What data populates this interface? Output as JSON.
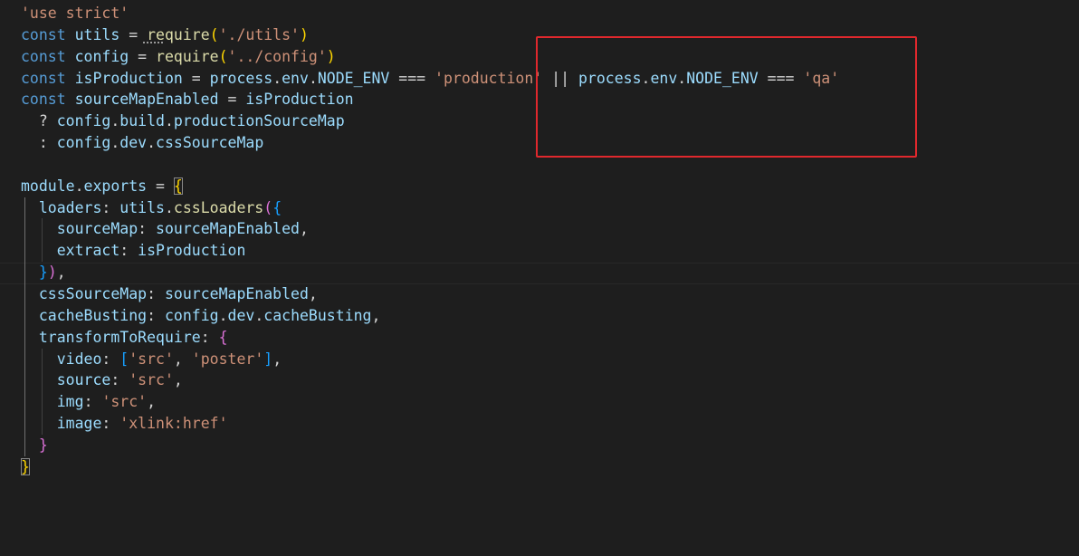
{
  "colors": {
    "background": "#1e1e1e",
    "keyword": "#569cd6",
    "variable": "#9cdcfe",
    "function": "#dcdcaa",
    "string": "#ce9178",
    "text": "#d4d4d4",
    "bracket_gold": "#ffd700",
    "bracket_purple": "#da70d6",
    "bracket_blue": "#179fff",
    "annotation_box": "#e0282d"
  },
  "code": {
    "lines": [
      {
        "tokens": [
          {
            "t": "'use strict'",
            "c": "string"
          }
        ]
      },
      {
        "tokens": [
          {
            "t": "const",
            "c": "keyword"
          },
          {
            "t": " ",
            "c": "text"
          },
          {
            "t": "utils",
            "c": "variable"
          },
          {
            "t": " = ",
            "c": "text"
          },
          {
            "t": "require",
            "c": "function"
          },
          {
            "t": "(",
            "c": "bracket_gold"
          },
          {
            "t": "'./utils'",
            "c": "string"
          },
          {
            "t": ")",
            "c": "bracket_gold"
          }
        ]
      },
      {
        "tokens": [
          {
            "t": "const",
            "c": "keyword"
          },
          {
            "t": " ",
            "c": "text"
          },
          {
            "t": "config",
            "c": "variable"
          },
          {
            "t": " = ",
            "c": "text"
          },
          {
            "t": "require",
            "c": "function"
          },
          {
            "t": "(",
            "c": "bracket_gold"
          },
          {
            "t": "'../config'",
            "c": "string"
          },
          {
            "t": ")",
            "c": "bracket_gold"
          }
        ]
      },
      {
        "tokens": [
          {
            "t": "const",
            "c": "keyword"
          },
          {
            "t": " ",
            "c": "text"
          },
          {
            "t": "isProduction",
            "c": "variable"
          },
          {
            "t": " = ",
            "c": "text"
          },
          {
            "t": "process",
            "c": "variable"
          },
          {
            "t": ".",
            "c": "text"
          },
          {
            "t": "env",
            "c": "variable"
          },
          {
            "t": ".",
            "c": "text"
          },
          {
            "t": "NODE_ENV",
            "c": "variable"
          },
          {
            "t": " === ",
            "c": "text"
          },
          {
            "t": "'production'",
            "c": "string"
          },
          {
            "t": " || ",
            "c": "text"
          },
          {
            "t": "process",
            "c": "variable"
          },
          {
            "t": ".",
            "c": "text"
          },
          {
            "t": "env",
            "c": "variable"
          },
          {
            "t": ".",
            "c": "text"
          },
          {
            "t": "NODE_ENV",
            "c": "variable"
          },
          {
            "t": " === ",
            "c": "text"
          },
          {
            "t": "'qa'",
            "c": "string"
          }
        ]
      },
      {
        "tokens": [
          {
            "t": "const",
            "c": "keyword"
          },
          {
            "t": " ",
            "c": "text"
          },
          {
            "t": "sourceMapEnabled",
            "c": "variable"
          },
          {
            "t": " = ",
            "c": "text"
          },
          {
            "t": "isProduction",
            "c": "variable"
          }
        ]
      },
      {
        "tokens": [
          {
            "t": "  ? ",
            "c": "text"
          },
          {
            "t": "config",
            "c": "variable"
          },
          {
            "t": ".",
            "c": "text"
          },
          {
            "t": "build",
            "c": "variable"
          },
          {
            "t": ".",
            "c": "text"
          },
          {
            "t": "productionSourceMap",
            "c": "variable"
          }
        ]
      },
      {
        "tokens": [
          {
            "t": "  : ",
            "c": "text"
          },
          {
            "t": "config",
            "c": "variable"
          },
          {
            "t": ".",
            "c": "text"
          },
          {
            "t": "dev",
            "c": "variable"
          },
          {
            "t": ".",
            "c": "text"
          },
          {
            "t": "cssSourceMap",
            "c": "variable"
          }
        ]
      },
      {
        "tokens": []
      },
      {
        "tokens": [
          {
            "t": "module",
            "c": "variable"
          },
          {
            "t": ".",
            "c": "text"
          },
          {
            "t": "exports",
            "c": "variable"
          },
          {
            "t": " = ",
            "c": "text"
          },
          {
            "t": "{",
            "c": "bracket_gold"
          }
        ]
      },
      {
        "tokens": [
          {
            "t": "  ",
            "c": "text"
          },
          {
            "t": "loaders",
            "c": "variable"
          },
          {
            "t": ": ",
            "c": "text"
          },
          {
            "t": "utils",
            "c": "variable"
          },
          {
            "t": ".",
            "c": "text"
          },
          {
            "t": "cssLoaders",
            "c": "function"
          },
          {
            "t": "(",
            "c": "bracket_purple"
          },
          {
            "t": "{",
            "c": "bracket_blue"
          }
        ]
      },
      {
        "tokens": [
          {
            "t": "    ",
            "c": "text"
          },
          {
            "t": "sourceMap",
            "c": "variable"
          },
          {
            "t": ": ",
            "c": "text"
          },
          {
            "t": "sourceMapEnabled",
            "c": "variable"
          },
          {
            "t": ",",
            "c": "text"
          }
        ]
      },
      {
        "tokens": [
          {
            "t": "    ",
            "c": "text"
          },
          {
            "t": "extract",
            "c": "variable"
          },
          {
            "t": ": ",
            "c": "text"
          },
          {
            "t": "isProduction",
            "c": "variable"
          }
        ]
      },
      {
        "tokens": [
          {
            "t": "  ",
            "c": "text"
          },
          {
            "t": "}",
            "c": "bracket_blue"
          },
          {
            "t": ")",
            "c": "bracket_purple"
          },
          {
            "t": ",",
            "c": "text"
          }
        ]
      },
      {
        "tokens": [
          {
            "t": "  ",
            "c": "text"
          },
          {
            "t": "cssSourceMap",
            "c": "variable"
          },
          {
            "t": ": ",
            "c": "text"
          },
          {
            "t": "sourceMapEnabled",
            "c": "variable"
          },
          {
            "t": ",",
            "c": "text"
          }
        ]
      },
      {
        "tokens": [
          {
            "t": "  ",
            "c": "text"
          },
          {
            "t": "cacheBusting",
            "c": "variable"
          },
          {
            "t": ": ",
            "c": "text"
          },
          {
            "t": "config",
            "c": "variable"
          },
          {
            "t": ".",
            "c": "text"
          },
          {
            "t": "dev",
            "c": "variable"
          },
          {
            "t": ".",
            "c": "text"
          },
          {
            "t": "cacheBusting",
            "c": "variable"
          },
          {
            "t": ",",
            "c": "text"
          }
        ]
      },
      {
        "tokens": [
          {
            "t": "  ",
            "c": "text"
          },
          {
            "t": "transformToRequire",
            "c": "variable"
          },
          {
            "t": ": ",
            "c": "text"
          },
          {
            "t": "{",
            "c": "bracket_purple"
          }
        ]
      },
      {
        "tokens": [
          {
            "t": "    ",
            "c": "text"
          },
          {
            "t": "video",
            "c": "variable"
          },
          {
            "t": ": ",
            "c": "text"
          },
          {
            "t": "[",
            "c": "bracket_blue"
          },
          {
            "t": "'src'",
            "c": "string"
          },
          {
            "t": ", ",
            "c": "text"
          },
          {
            "t": "'poster'",
            "c": "string"
          },
          {
            "t": "]",
            "c": "bracket_blue"
          },
          {
            "t": ",",
            "c": "text"
          }
        ]
      },
      {
        "tokens": [
          {
            "t": "    ",
            "c": "text"
          },
          {
            "t": "source",
            "c": "variable"
          },
          {
            "t": ": ",
            "c": "text"
          },
          {
            "t": "'src'",
            "c": "string"
          },
          {
            "t": ",",
            "c": "text"
          }
        ]
      },
      {
        "tokens": [
          {
            "t": "    ",
            "c": "text"
          },
          {
            "t": "img",
            "c": "variable"
          },
          {
            "t": ": ",
            "c": "text"
          },
          {
            "t": "'src'",
            "c": "string"
          },
          {
            "t": ",",
            "c": "text"
          }
        ]
      },
      {
        "tokens": [
          {
            "t": "    ",
            "c": "text"
          },
          {
            "t": "image",
            "c": "variable"
          },
          {
            "t": ": ",
            "c": "text"
          },
          {
            "t": "'xlink:href'",
            "c": "string"
          }
        ]
      },
      {
        "tokens": [
          {
            "t": "  ",
            "c": "text"
          },
          {
            "t": "}",
            "c": "bracket_purple"
          }
        ]
      },
      {
        "tokens": [
          {
            "t": "}",
            "c": "bracket_gold"
          }
        ]
      }
    ]
  }
}
